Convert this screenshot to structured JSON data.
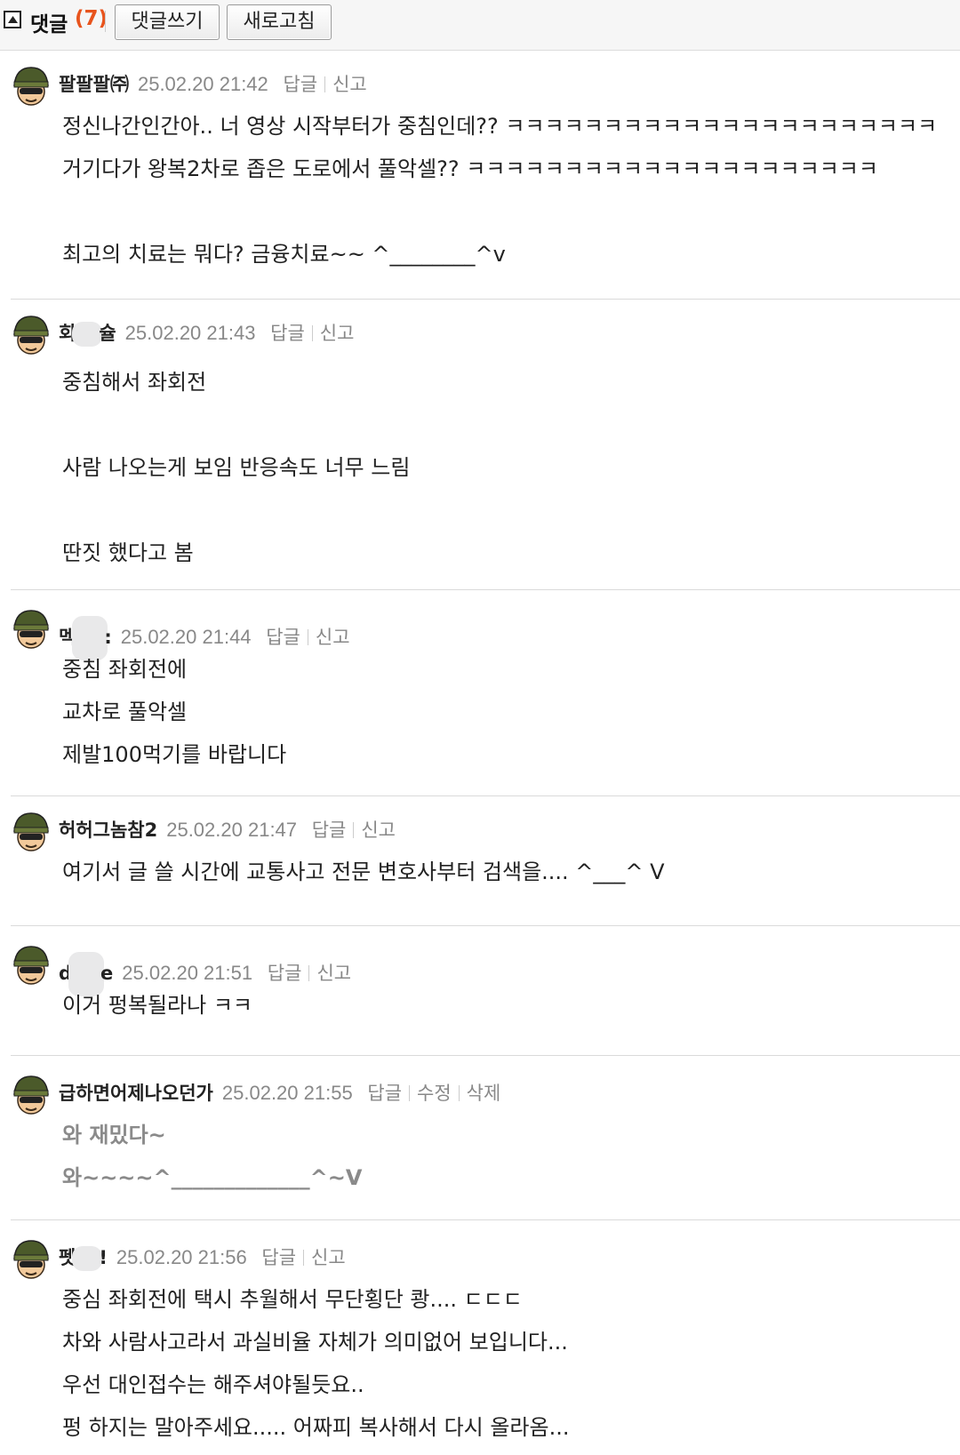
{
  "header": {
    "title": "댓글",
    "count": "(7)",
    "write_button": "댓글쓰기",
    "refresh_button": "새로고침"
  },
  "actions": {
    "reply": "답글",
    "report": "신고",
    "edit": "수정",
    "delete": "삭제"
  },
  "comments": [
    {
      "nick_a": "팔팔팔㈜",
      "nick_b": "",
      "date": "25.02.20 21:42",
      "lines": [
        "정신나간인간아.. 너 영상 시작부터가 중침인데?? ㅋㅋㅋㅋㅋㅋㅋㅋㅋㅋㅋㅋㅋㅋㅋㅋㅋㅋㅋㅋㅋㅋ",
        "거기다가 왕복2차로 좁은 도로에서 풀악셀?? ㅋㅋㅋㅋㅋㅋㅋㅋㅋㅋㅋㅋㅋㅋㅋㅋㅋㅋㅋㅋㅋ",
        "",
        "최고의 치료는 뭐다? 금융치료~~ ^________^v"
      ]
    },
    {
      "nick_a": "회",
      "nick_b": "슐",
      "date": "25.02.20 21:43",
      "lines": [
        "중침해서 좌회전",
        "",
        "사람 나오는게 보임 반응속도 너무 느림",
        "",
        "딴짓 했다고 봄"
      ]
    },
    {
      "nick_a": "멕",
      "nick_b": ":",
      "date": "25.02.20 21:44",
      "lines": [
        "중침 좌회전에",
        "교차로 풀악셀",
        "제발100먹기를 바랍니다"
      ]
    },
    {
      "nick_a": "허허그놈참2",
      "nick_b": "",
      "date": "25.02.20 21:47",
      "lines": [
        "여기서 글 쓸 시간에 교통사고 전문 변호사부터 검색을.... ^___^ V"
      ]
    },
    {
      "nick_a": "d",
      "nick_b": "e",
      "date": "25.02.20 21:51",
      "lines": [
        "이거 펑복될라나 ㅋㅋ"
      ]
    },
    {
      "nick_a": "급하면어제나오던가",
      "nick_b": "",
      "date": "25.02.20 21:55",
      "lines": [
        "와 재밌다~",
        "와~~~~^_____________^~V"
      ]
    },
    {
      "nick_a": "펫",
      "nick_b": "!",
      "date": "25.02.20 21:56",
      "lines": [
        "중심 좌회전에 택시 추월해서 무단횡단 쾅.... ㄷㄷㄷ",
        "차와 사람사고라서 과실비율 자체가 의미없어 보입니다...",
        "우선 대인접수는 해주셔야될듯요..",
        "펑 하지는 말아주세요..... 어짜피 복사해서 다시 올라옴..."
      ]
    }
  ],
  "colors": {
    "count": "#e8541d",
    "meta": "#888888",
    "divider": "#dadada"
  }
}
